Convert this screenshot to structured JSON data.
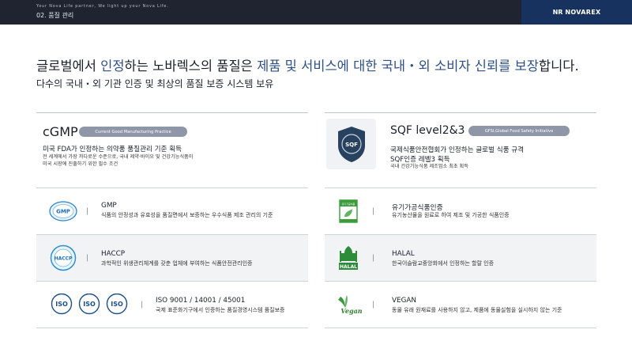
{
  "header": {
    "tagline": "Your Nova Life partner, We light up your Nova Life.",
    "section": "02. 품질 관리",
    "brand_name": "NOVAREX",
    "brand_mark": "NR"
  },
  "headline": {
    "part1": "글로벌에서 ",
    "part2": "인정",
    "part3": "하는 노바렉스의 품질은 ",
    "part4": "제품 및 서비스에 대한 국내・외 소비자 신뢰를 보장",
    "part5": "합니다."
  },
  "subline": "다수의 국내・외 기관 인증 및 최상의 품질 보증 시스템 보유",
  "cgmp": {
    "title": "cGMP",
    "pill": "Current Good Manufacturing Practice",
    "desc": "미국 FDA가 인정하는 의약품 품질관리 기준 획득",
    "small1": "전 세계에서 가장 까다로운 수준으로, 국내 제약·바이오 및 건강기능식품이",
    "small2": "미국 시장에 진출하기 위한 필수 조건"
  },
  "sqf": {
    "title": "SQF level2&3",
    "pill": "GFSI,Global Food Safety Initiative",
    "desc1": "국제식품안전협회가 인정하는 글로벌 식품 규격",
    "desc2": "SQF인증 레벨3 획득",
    "small": "국내 건강기능식품 제조업소 최초 획득",
    "logo_text": "SQF"
  },
  "left_rows": [
    {
      "title": "GMP",
      "desc": "식품의 안정성과 유효성을 품질면에서 보증하는 우수식품 제조 관리의 기준",
      "icon": "GMP"
    },
    {
      "title": "HACCP",
      "desc": "과학적인 위생관리체계를 갖춘 업체에 부여하는 식품안전관리인증",
      "icon": "HACCP"
    },
    {
      "title": "ISO 9001 / 14001 / 45001",
      "desc": "국제 표준화기구에서 인증하는 품질경영시스템 품질보증",
      "icon": "ISO"
    }
  ],
  "right_rows": [
    {
      "title": "유기가공식품인증",
      "desc": "유기농산물을 원료로 하여 제조 및 가공한 식품인증",
      "icon": "유기가공식품"
    },
    {
      "title": "HALAL",
      "desc": "한국이슬람교중앙회에서 인정하는 할랄 인증",
      "icon": "HALAL"
    },
    {
      "title": "VEGAN",
      "desc": "동물 유래 원재료를 사용하지 않고, 제품에 동물실험을 실시하지 않는 기준",
      "icon": "Vegan"
    }
  ],
  "colors": {
    "topbar": "#1f2430",
    "brand_bg": "#17325f",
    "accent": "#2b4f86",
    "pill": "#8e96a8",
    "row_shade": "#f2f3f5"
  }
}
